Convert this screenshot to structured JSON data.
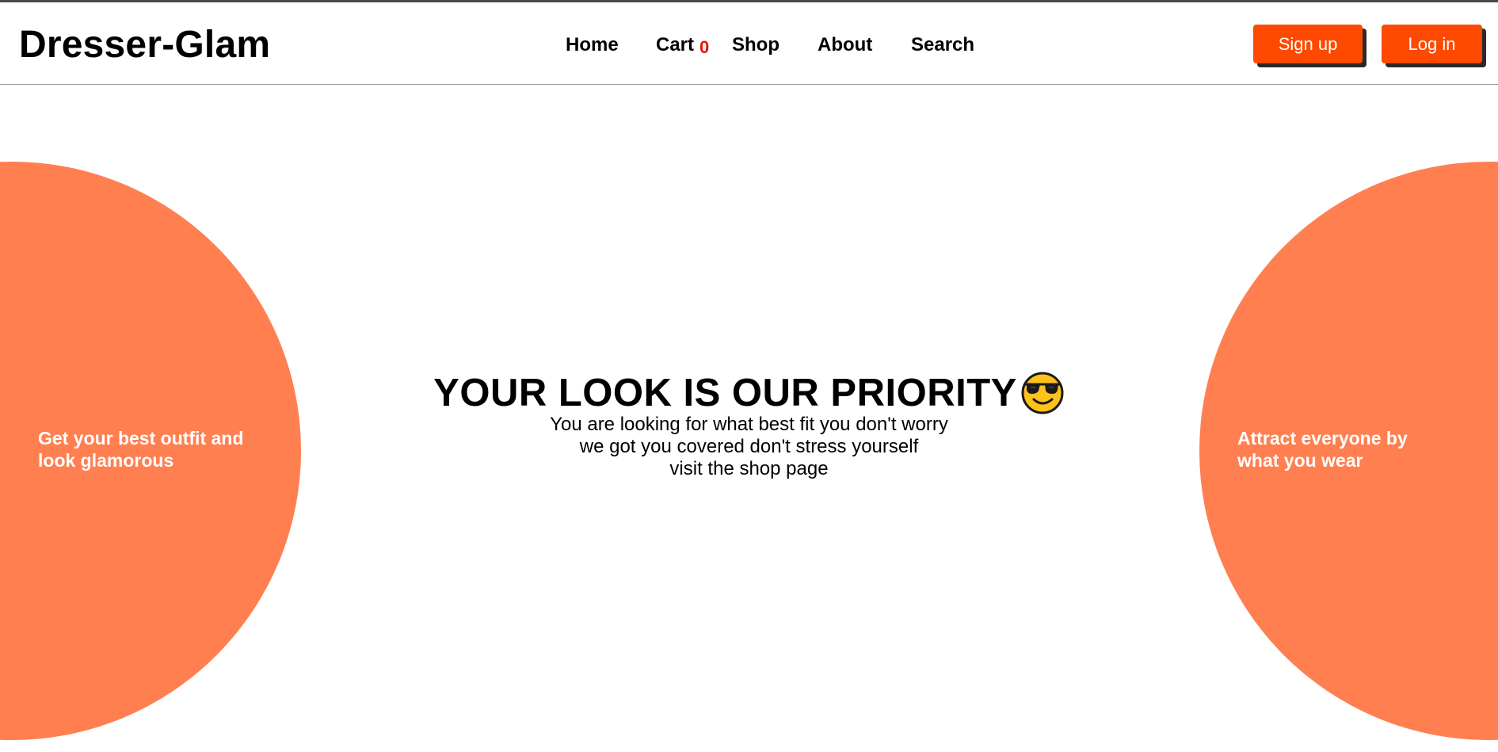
{
  "brand": "Dresser-Glam",
  "nav": {
    "home": "Home",
    "cart": "Cart",
    "cart_count": "0",
    "shop": "Shop",
    "about": "About",
    "search": "Search"
  },
  "auth": {
    "signup": "Sign up",
    "login": "Log in"
  },
  "hero": {
    "title": "YOUR LOOK IS OUR PRIORITY",
    "emoji_icon": "smiling-face-with-sunglasses-icon",
    "lines": [
      "You are looking for what best fit you don't worry",
      "we got you covered don't stress yourself",
      "visit the shop page"
    ]
  },
  "left_circle": {
    "lines": [
      "Get your best outfit and",
      "look glamorous"
    ]
  },
  "right_circle": {
    "lines": [
      "Attract everyone by",
      "what you wear"
    ]
  },
  "colors": {
    "accent": "#fe4a01",
    "circle": "#ff7f50",
    "cart_count": "#e8140a"
  }
}
